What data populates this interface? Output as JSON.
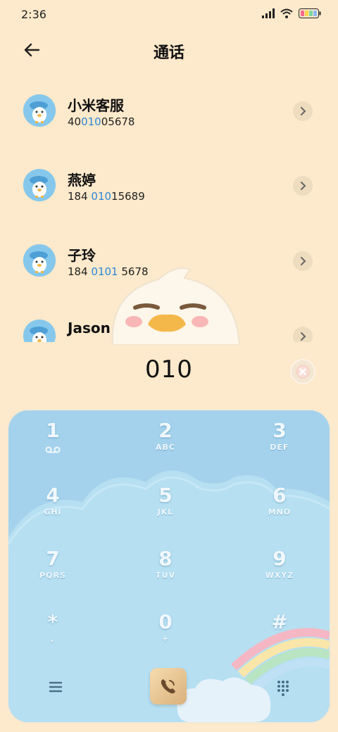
{
  "status_bar": {
    "time": "2:36"
  },
  "header": {
    "title": "通话"
  },
  "contacts": [
    {
      "name": "小米客服",
      "number_pre": "40",
      "number_hl": "010",
      "number_post": "05678"
    },
    {
      "name": "燕婷",
      "number_pre": "184 ",
      "number_hl": "010",
      "number_post": "15689"
    },
    {
      "name": "子玲",
      "number_pre": "184 ",
      "number_hl": "0101",
      "number_post": " 5678"
    },
    {
      "name": "Jason",
      "number_pre": "",
      "number_hl": "",
      "number_post": ""
    }
  ],
  "dialed_number": "010",
  "keypad": {
    "keys": [
      {
        "digit": "1",
        "letters": ""
      },
      {
        "digit": "2",
        "letters": "ABC"
      },
      {
        "digit": "3",
        "letters": "DEF"
      },
      {
        "digit": "4",
        "letters": "GHI"
      },
      {
        "digit": "5",
        "letters": "JKL"
      },
      {
        "digit": "6",
        "letters": "MNO"
      },
      {
        "digit": "7",
        "letters": "PQRS"
      },
      {
        "digit": "8",
        "letters": "TUV"
      },
      {
        "digit": "9",
        "letters": "WXYZ"
      },
      {
        "digit": "*",
        "letters": ""
      },
      {
        "digit": "0",
        "letters": ""
      },
      {
        "digit": "#",
        "letters": ""
      }
    ]
  },
  "colors": {
    "background": "#fde9cb",
    "highlight": "#2a87d8",
    "keypad": "#a8d4ec"
  },
  "icons": {
    "back": "back-arrow-icon",
    "chevron": "chevron-right-icon",
    "delete": "backspace-icon",
    "menu": "menu-icon",
    "call": "phone-icon",
    "dialpad": "dialpad-icon"
  }
}
